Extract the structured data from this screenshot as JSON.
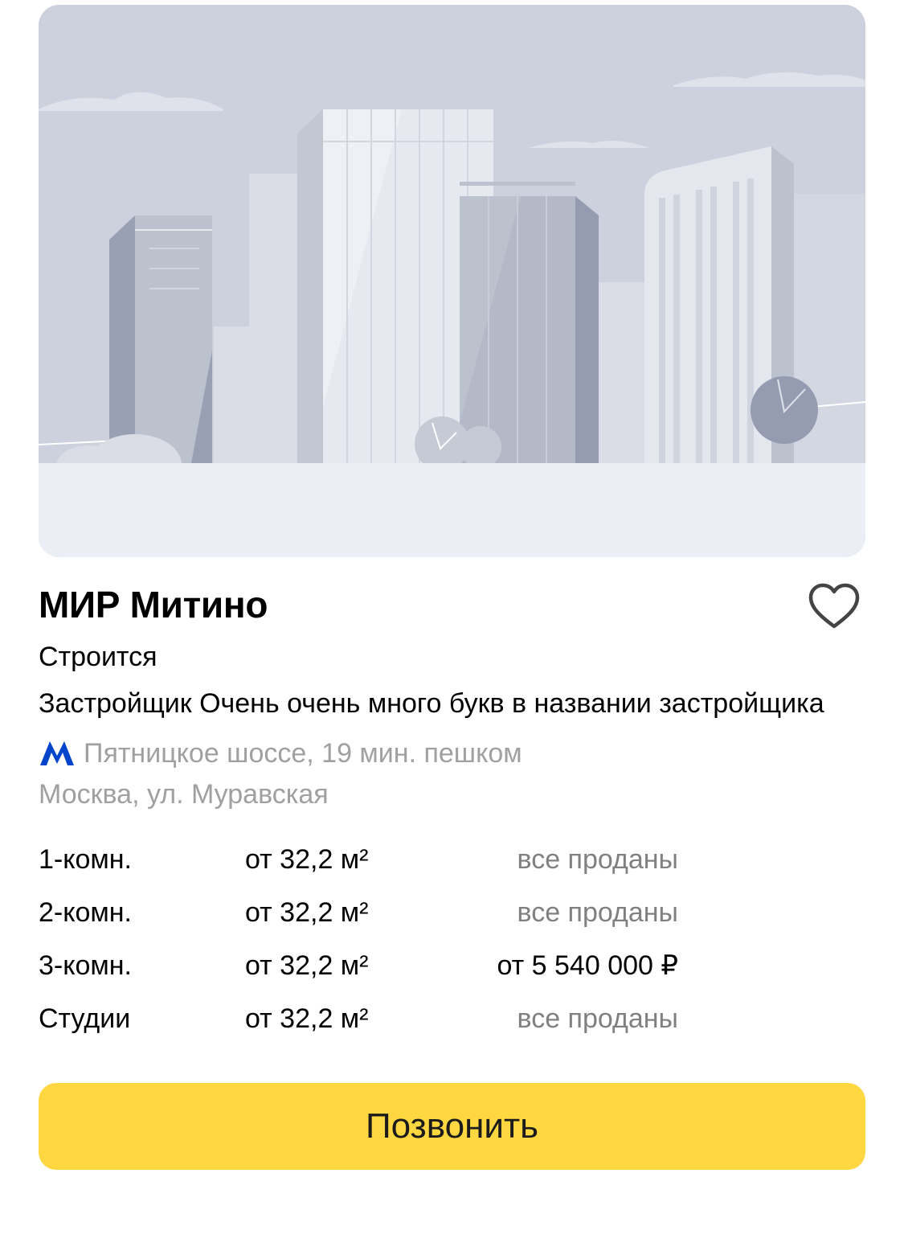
{
  "complex": {
    "title": "МИР Митино",
    "status": "Строится",
    "developer": "Застройщик Очень очень много букв в названии застройщика",
    "metro": {
      "station": "Пятницкое шоссе, 19 мин. пешком",
      "icon": "metro-icon",
      "color": "#0044cc"
    },
    "address": "Москва, ул. Муравская"
  },
  "flats": [
    {
      "type": "1-комн.",
      "area": "от 32,2 м²",
      "price": "все проданы",
      "sold": true
    },
    {
      "type": "2-комн.",
      "area": "от 32,2 м²",
      "price": "все проданы",
      "sold": true
    },
    {
      "type": "3-комн.",
      "area": "от 32,2 м²",
      "price": "от 5 540 000 ₽",
      "sold": false
    },
    {
      "type": "Студии",
      "area": "от 32,2 м²",
      "price": "все проданы",
      "sold": true
    }
  ],
  "actions": {
    "call_label": "Позвонить",
    "favorite_icon": "heart-outline-icon"
  },
  "colors": {
    "accent": "#ffd740",
    "secondary_text": "#a0a0a0",
    "sold_text": "#808080"
  }
}
